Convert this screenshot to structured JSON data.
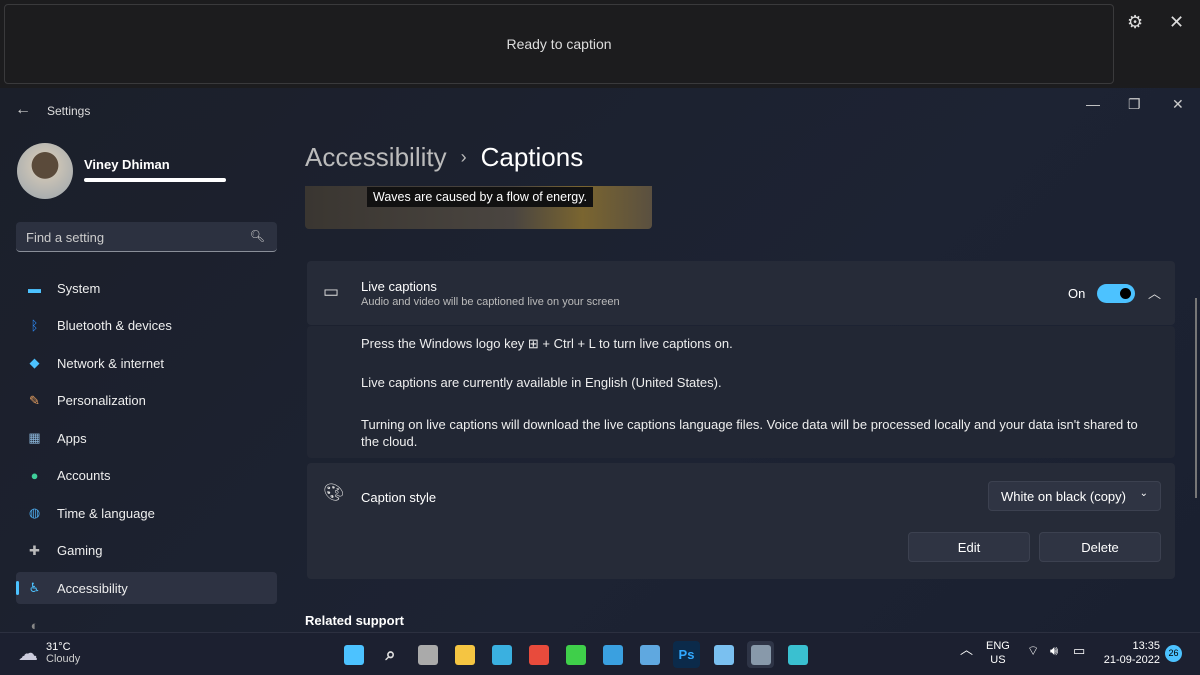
{
  "caption_bar": {
    "status": "Ready to caption"
  },
  "window": {
    "title": "Settings"
  },
  "user": {
    "name": "Viney Dhiman"
  },
  "search": {
    "placeholder": "Find a setting"
  },
  "nav": [
    {
      "label": "System",
      "icon": "monitor-icon",
      "color": "#4cc2ff"
    },
    {
      "label": "Bluetooth & devices",
      "icon": "bluetooth-icon",
      "color": "#2f8fff"
    },
    {
      "label": "Network & internet",
      "icon": "wifi-icon",
      "color": "#4cc2ff"
    },
    {
      "label": "Personalization",
      "icon": "brush-icon",
      "color": "#e8a060"
    },
    {
      "label": "Apps",
      "icon": "apps-icon",
      "color": "#8ab4d8"
    },
    {
      "label": "Accounts",
      "icon": "person-icon",
      "color": "#3fcf9a"
    },
    {
      "label": "Time & language",
      "icon": "globe-icon",
      "color": "#4ca8e8"
    },
    {
      "label": "Gaming",
      "icon": "gamepad-icon",
      "color": "#bbbbbb"
    },
    {
      "label": "Accessibility",
      "icon": "accessibility-icon",
      "color": "#4cc2ff",
      "active": true
    },
    {
      "label": "",
      "icon": "privacy-icon",
      "color": "#888888"
    }
  ],
  "breadcrumb": {
    "parent": "Accessibility",
    "current": "Captions"
  },
  "preview": {
    "caption": "Waves are caused by a flow of energy."
  },
  "live_captions": {
    "title": "Live captions",
    "subtitle": "Audio and video will be captioned live on your screen",
    "state": "On",
    "enabled": true,
    "info": [
      "Press the Windows logo key ⊞ + Ctrl + L to turn live captions on.",
      "Live captions are currently available in English (United States).",
      "Turning on live captions will download the live captions language files. Voice data will be processed locally and your data isn't shared to the cloud."
    ]
  },
  "caption_style": {
    "title": "Caption style",
    "selected": "White on black (copy)",
    "edit": "Edit",
    "delete": "Delete"
  },
  "related": "Related support",
  "taskbar": {
    "temp": "31°C",
    "weather": "Cloudy",
    "lang": "ENG",
    "region": "US",
    "time": "13:35",
    "date": "21-09-2022",
    "notifications": "26",
    "apps": [
      {
        "icon": "start-icon",
        "color": "#4cc2ff"
      },
      {
        "icon": "search-icon",
        "color": "#dddddd"
      },
      {
        "icon": "task-view-icon",
        "color": "#aaaaaa"
      },
      {
        "icon": "file-explorer-icon",
        "color": "#f5c542"
      },
      {
        "icon": "edge-icon",
        "color": "#3ab0e0"
      },
      {
        "icon": "store-icon",
        "color": "#e84b3c"
      },
      {
        "icon": "app-icon",
        "color": "#3fcf4a"
      },
      {
        "icon": "app-icon",
        "color": "#3aa0e0"
      },
      {
        "icon": "paint-icon",
        "color": "#5fa8e0"
      },
      {
        "icon": "photoshop-icon",
        "color": "#0b2a4a",
        "text": "Ps"
      },
      {
        "icon": "notepad-icon",
        "color": "#7ac0f0"
      },
      {
        "icon": "settings-icon",
        "color": "#8899aa"
      },
      {
        "icon": "remote-desktop-icon",
        "color": "#3ac0d0"
      }
    ]
  }
}
